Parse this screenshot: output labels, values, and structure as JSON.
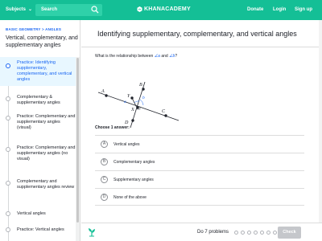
{
  "header": {
    "subjects_label": "Subjects",
    "search_placeholder": "Search",
    "brand": "KHANACADEMY",
    "nav": [
      "Donate",
      "Login",
      "Sign up"
    ],
    "color": "#14bf96"
  },
  "sidebar": {
    "breadcrumb": "BASIC GEOMETRY  > ANGLES",
    "topic_title": "Vertical, complementary, and supplementary angles",
    "items": [
      {
        "label": "Practice: Identifying supplementary, complementary, and vertical angles",
        "active": true
      },
      {
        "label": "Complementary & supplementary angles",
        "active": false
      },
      {
        "label": "Practice: Complementary and supplementary angles (visual)",
        "active": false
      },
      {
        "label": "Practice: Complementary and supplementary angles (no visual)",
        "active": false
      },
      {
        "label": "Complementary and supplementary angles review",
        "active": false
      },
      {
        "label": "Vertical angles",
        "active": false
      },
      {
        "label": "Practice: Vertical angles",
        "active": false
      }
    ]
  },
  "exercise": {
    "title": "Identifying supplementary, complementary, and vertical angles",
    "question_prefix": "What is the relationship between",
    "angle_1": "∠a",
    "question_and": "and",
    "angle_2": "∠b",
    "question_suffix": "?",
    "diagram_labels": {
      "A": "A",
      "B": "B",
      "C": "C",
      "D": "D",
      "X": "X",
      "Y": "Y",
      "a": "a",
      "b": "b"
    },
    "choose_label": "Choose 1 answer:",
    "choices": [
      {
        "letter": "A",
        "text": "Vertical angles"
      },
      {
        "letter": "B",
        "text": "Complementary angles"
      },
      {
        "letter": "C",
        "text": "Supplementary angles"
      },
      {
        "letter": "D",
        "text": "None of the above"
      }
    ]
  },
  "footer": {
    "progress_text": "Do 7 problems",
    "check_label": "Check"
  }
}
